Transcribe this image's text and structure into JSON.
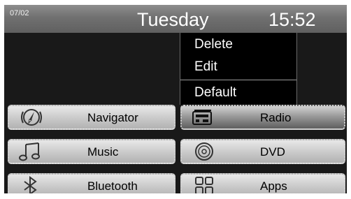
{
  "status": {
    "date": "07/02",
    "day": "Tuesday",
    "time": "15:52"
  },
  "context_menu": {
    "items": [
      "Delete",
      "Edit",
      "Default"
    ]
  },
  "tiles": {
    "navigator": {
      "label": "Navigator",
      "icon": "compass-icon"
    },
    "radio": {
      "label": "Radio",
      "icon": "radio-icon"
    },
    "music": {
      "label": "Music",
      "icon": "music-note-icon"
    },
    "dvd": {
      "label": "DVD",
      "icon": "disc-icon"
    },
    "bluetooth": {
      "label": "Bluetooth",
      "icon": "bluetooth-icon"
    },
    "apps": {
      "label": "Apps",
      "icon": "apps-grid-icon"
    }
  }
}
